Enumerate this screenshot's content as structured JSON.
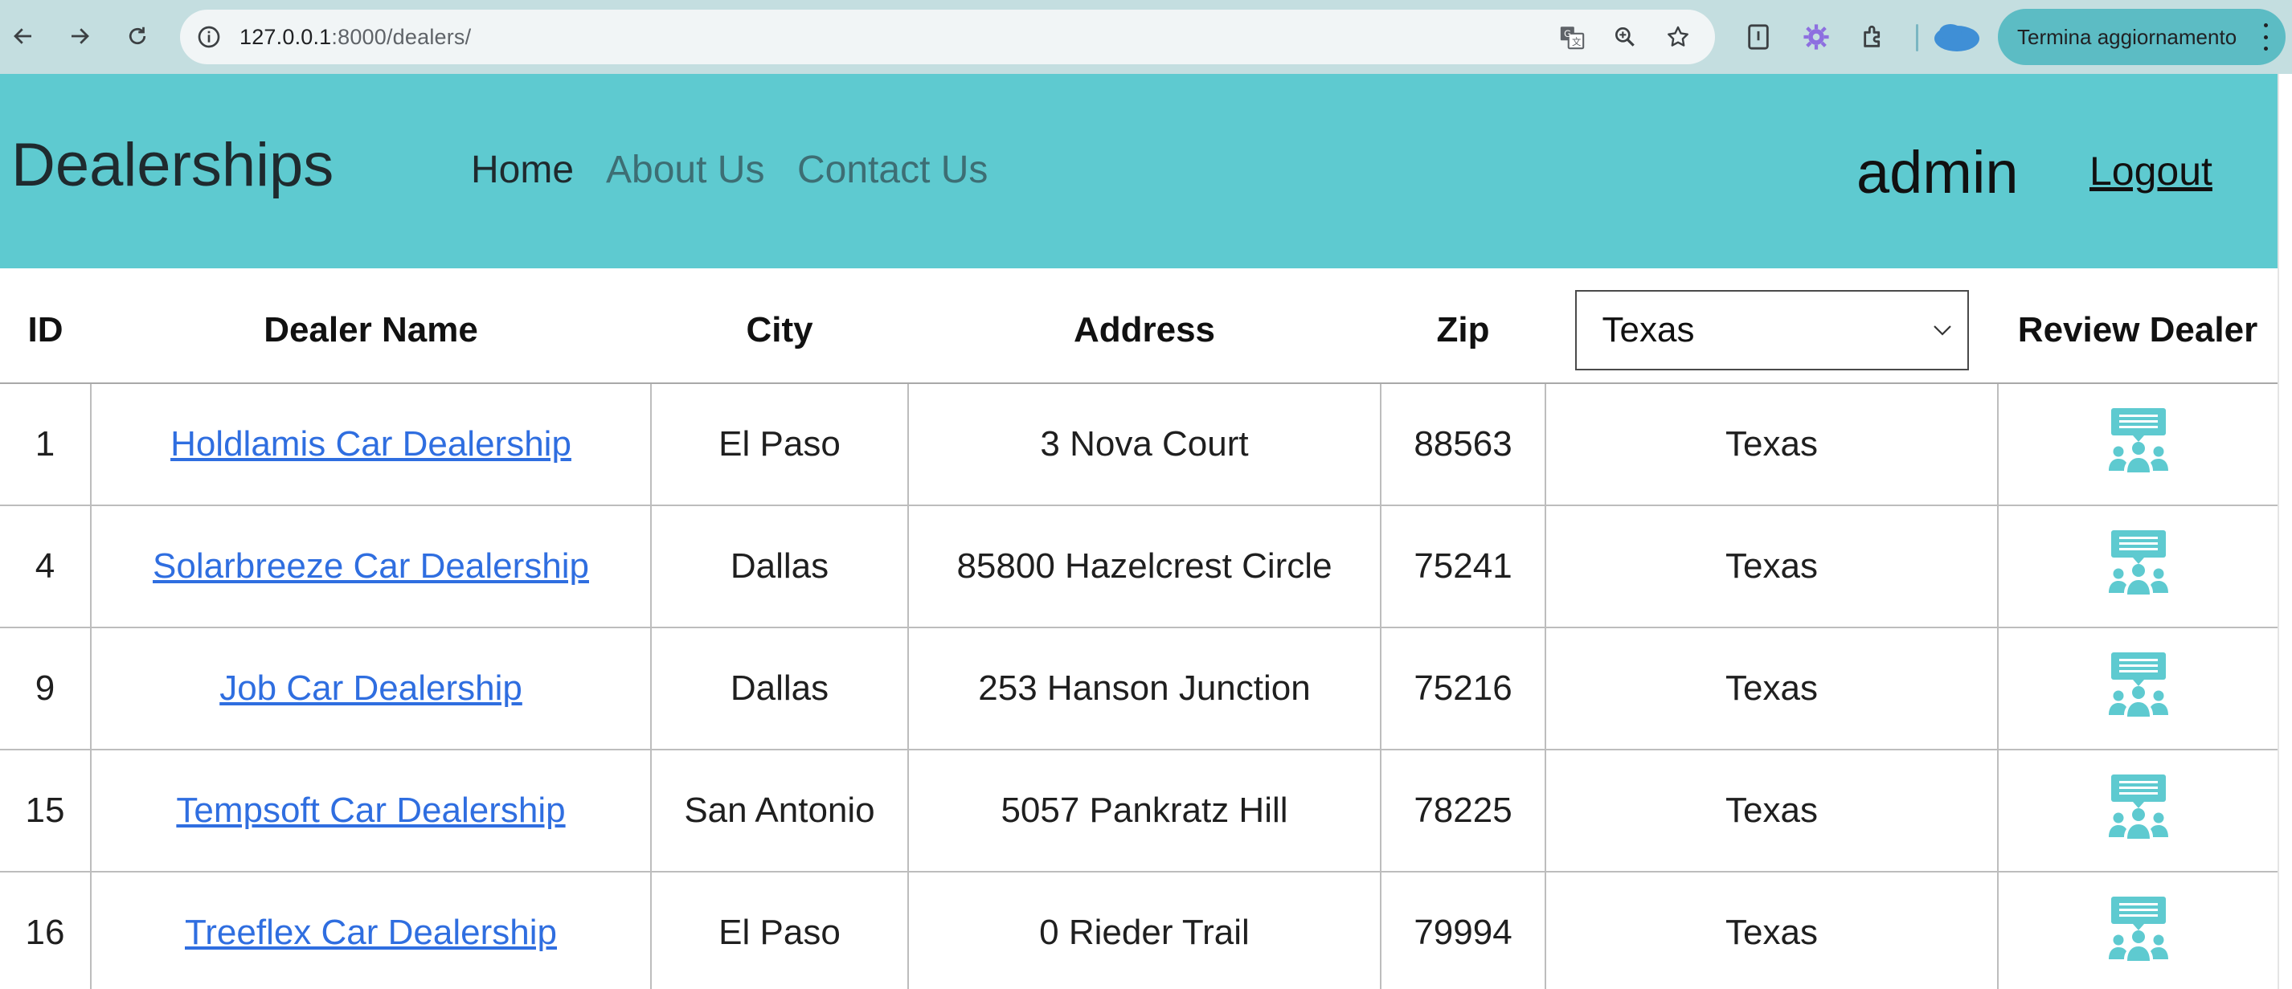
{
  "browser": {
    "url_host": "127.0.0.1",
    "url_rest": ":8000/dealers/",
    "update_label": "Termina aggiornamento",
    "icons": [
      "back-arrow-icon",
      "forward-arrow-icon",
      "reload-icon",
      "site-info-icon",
      "translate-icon",
      "zoom-icon",
      "bookmark-star-icon",
      "extension-page-icon",
      "extension-gear-icon",
      "extensions-puzzle-icon",
      "profile-cloud-icon",
      "more-menu-icon"
    ]
  },
  "header": {
    "brand": "Dealerships",
    "nav": {
      "home": "Home",
      "about": "About Us",
      "contact": "Contact Us"
    },
    "user": "admin",
    "logout": "Logout"
  },
  "table": {
    "columns": {
      "id": "ID",
      "name": "Dealer Name",
      "city": "City",
      "address": "Address",
      "zip": "Zip",
      "review": "Review Dealer"
    },
    "state_filter": {
      "selected": "Texas"
    },
    "rows": [
      {
        "id": "1",
        "name": "Holdlamis Car Dealership",
        "city": "El Paso",
        "address": "3 Nova Court",
        "zip": "88563",
        "state": "Texas"
      },
      {
        "id": "4",
        "name": "Solarbreeze Car Dealership",
        "city": "Dallas",
        "address": "85800 Hazelcrest Circle",
        "zip": "75241",
        "state": "Texas"
      },
      {
        "id": "9",
        "name": "Job Car Dealership",
        "city": "Dallas",
        "address": "253 Hanson Junction",
        "zip": "75216",
        "state": "Texas"
      },
      {
        "id": "15",
        "name": "Tempsoft Car Dealership",
        "city": "San Antonio",
        "address": "5057 Pankratz Hill",
        "zip": "78225",
        "state": "Texas"
      },
      {
        "id": "16",
        "name": "Treeflex Car Dealership",
        "city": "El Paso",
        "address": "0 Rieder Trail",
        "zip": "79994",
        "state": "Texas"
      }
    ]
  },
  "colors": {
    "header_bg": "#5ecad0",
    "link": "#2f6ee0",
    "chrome_bg": "#c4dee0",
    "icon": "#5ecad0"
  }
}
